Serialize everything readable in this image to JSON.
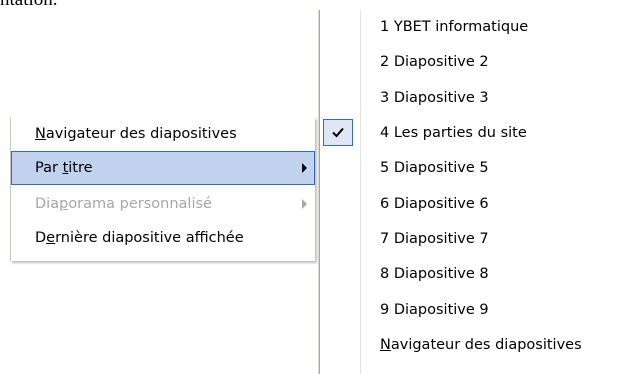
{
  "background": {
    "text": "ntation."
  },
  "left_menu": {
    "items": [
      {
        "prefix": "",
        "mnemonic": "N",
        "suffix": "avigateur des diapositives",
        "state": "normal",
        "submenu": false
      },
      {
        "prefix": "Par ",
        "mnemonic": "t",
        "suffix": "itre",
        "state": "highlight",
        "submenu": true
      },
      {
        "prefix": "Dia",
        "mnemonic": "p",
        "suffix": "orama personnalisé",
        "state": "disabled",
        "submenu": true
      },
      {
        "prefix": "D",
        "mnemonic": "e",
        "suffix": "rnière diapositive affichée",
        "state": "normal",
        "submenu": false
      }
    ]
  },
  "right_menu": {
    "checked_index": 3,
    "items": [
      {
        "label": "1 YBET informatique"
      },
      {
        "label": "2 Diapositive 2"
      },
      {
        "label": "3 Diapositive 3"
      },
      {
        "label": "4 Les parties du site"
      },
      {
        "label": "5 Diapositive 5"
      },
      {
        "label": "6 Diapositive 6"
      },
      {
        "label": "7 Diapositive 7"
      },
      {
        "label": "8 Diapositive 8"
      },
      {
        "label": "9 Diapositive 9"
      }
    ],
    "footer": {
      "prefix": "",
      "mnemonic": "N",
      "suffix": "avigateur des diapositives"
    }
  },
  "icons": {
    "check": "check-icon",
    "submenu_arrow": "arrow-right-icon"
  },
  "colors": {
    "highlight_bg": "#c1d2ee",
    "highlight_border": "#316ac5",
    "disabled_text": "#a7a6aa"
  }
}
